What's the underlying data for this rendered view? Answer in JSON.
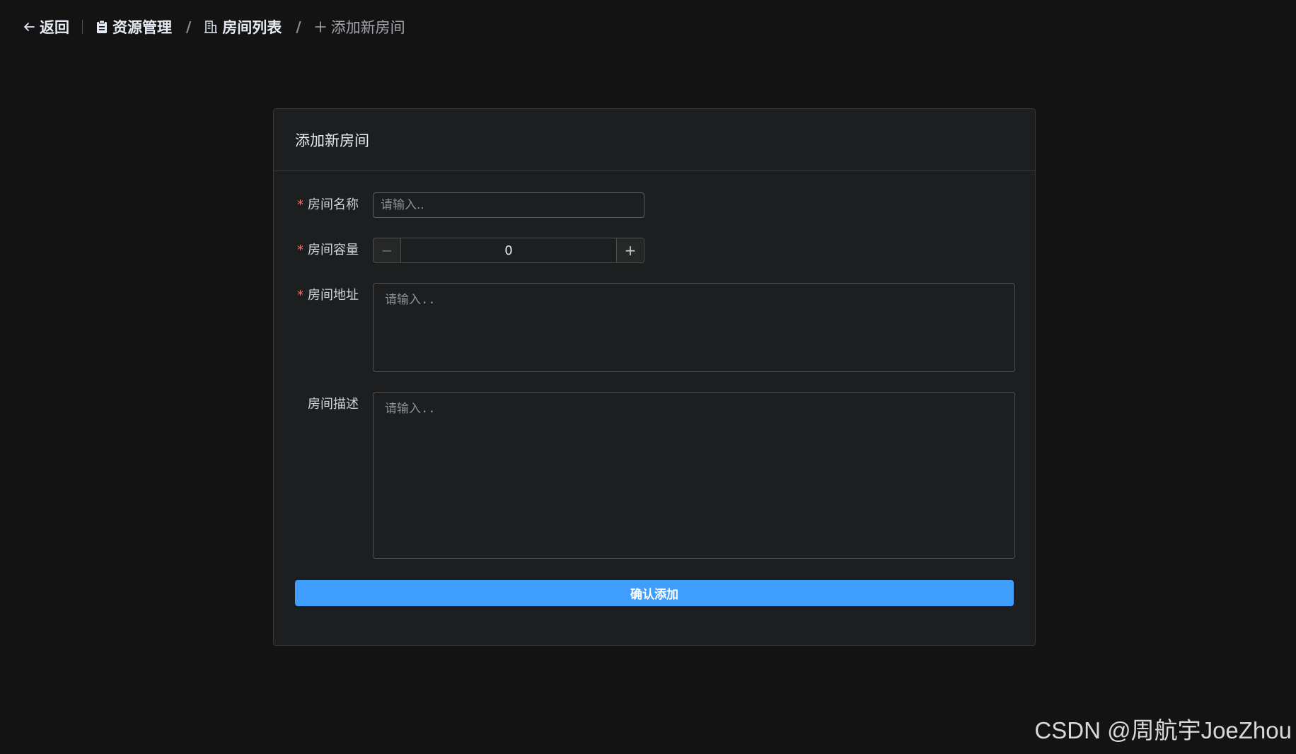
{
  "header": {
    "back_label": "返回",
    "breadcrumb": [
      {
        "label": "资源管理",
        "icon": "clipboard-icon"
      },
      {
        "label": "房间列表",
        "icon": "office-building-icon"
      },
      {
        "label": "添加新房间",
        "icon": "plus-icon"
      }
    ],
    "separator": "/"
  },
  "card": {
    "title": "添加新房间"
  },
  "form": {
    "required_mark": "*",
    "name": {
      "label": "房间名称",
      "placeholder": "请输入..",
      "value": ""
    },
    "capacity": {
      "label": "房间容量",
      "value": "0",
      "minus": "−",
      "plus": "+"
    },
    "address": {
      "label": "房间地址",
      "placeholder": "请输入..",
      "value": ""
    },
    "description": {
      "label": "房间描述",
      "placeholder": "请输入..",
      "value": ""
    },
    "submit_label": "确认添加"
  },
  "watermark": "CSDN @周航宇JoeZhou",
  "colors": {
    "background": "#131313",
    "card": "#1d1e1f",
    "primary": "#409eff",
    "required": "#f56c6c"
  }
}
